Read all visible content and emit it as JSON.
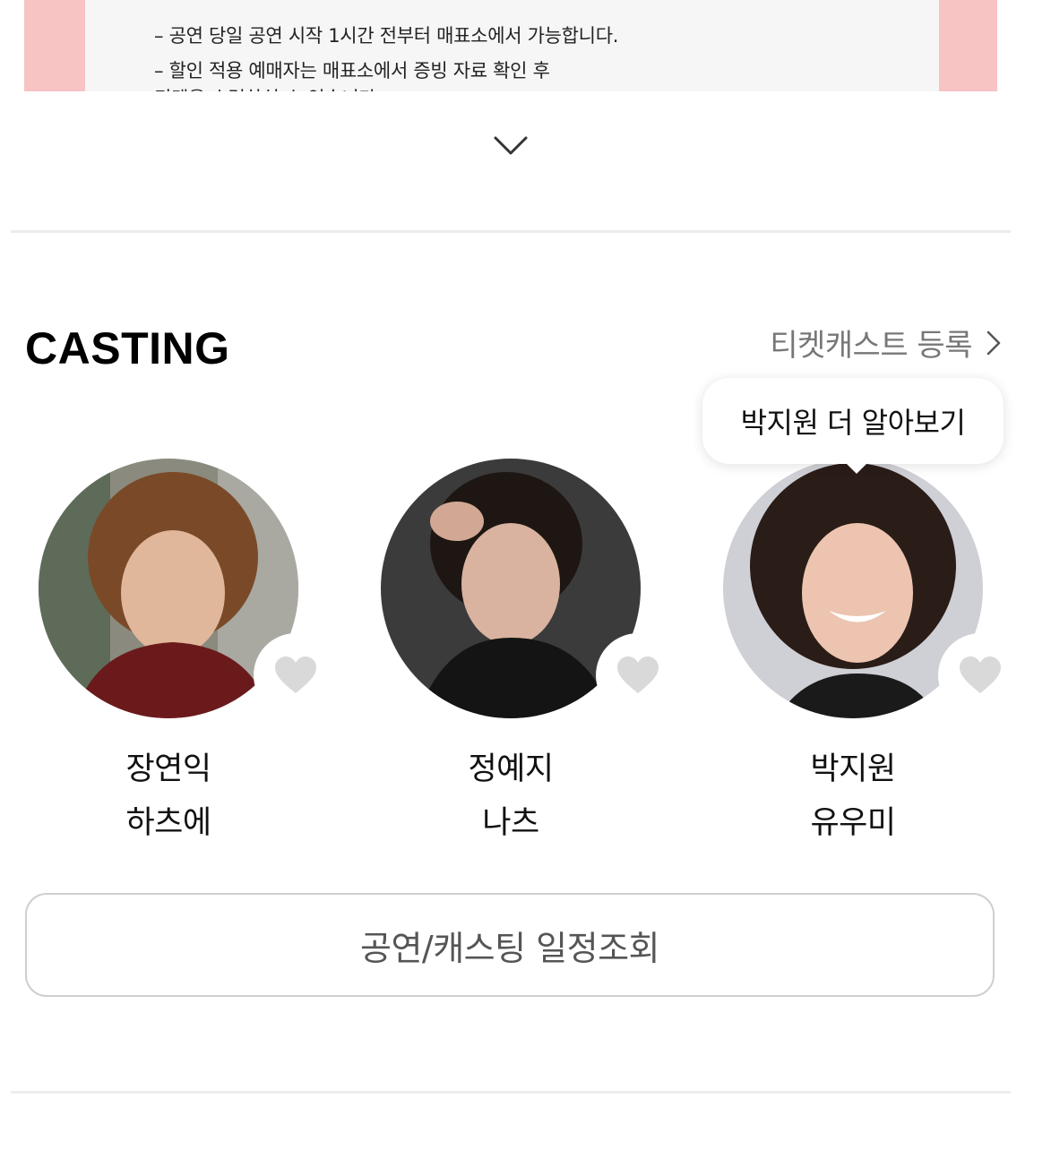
{
  "notice": {
    "line1": "– 공연 당일 공연 시작 1시간 전부터 매표소에서 가능합니다.",
    "line2": "– 할인 적용 예매자는 매표소에서 증빙 자료 확인 후",
    "line3": "티켓을 수령하실 수 있습니다."
  },
  "casting": {
    "title": "CASTING",
    "ticketcast_label": "티켓캐스트 등록",
    "tooltip": "박지원 더 알아보기",
    "members": [
      {
        "actor": "장연익",
        "role": "하츠에"
      },
      {
        "actor": "정예지",
        "role": "나츠"
      },
      {
        "actor": "박지원",
        "role": "유우미"
      }
    ],
    "schedule_button": "공연/캐스팅 일정조회"
  },
  "colors": {
    "accent_pink": "#f7c3c3",
    "heart_gray": "#d9d9d9",
    "link_gray": "#777777"
  },
  "icons": {
    "expand": "chevron-down-icon",
    "link": "chevron-right-icon",
    "favorite": "heart-icon"
  }
}
